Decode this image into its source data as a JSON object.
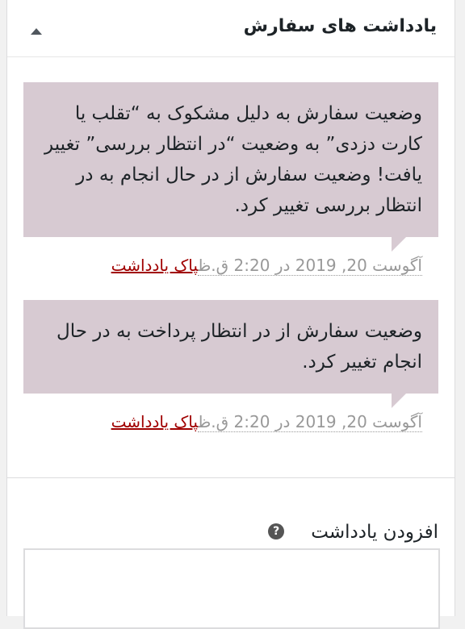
{
  "panel": {
    "title": "یادداشت های سفارش",
    "toggle_icon": "triangle-up-icon"
  },
  "notes": [
    {
      "text": "وضعیت سفارش به دلیل مشکوک به “تقلب یا کارت دزدی” به وضعیت “در انتظار بررسی” تغییر یافت! وضعیت سفارش از در حال انجام به در انتظار بررسی تغییر کرد.",
      "date": "آگوست 20, 2019 در 2:20 ق.ظ",
      "delete_label": "پاک یادداشت"
    },
    {
      "text": "وضعیت سفارش از در انتظار پرداخت به در حال انجام تغییر کرد.",
      "date": "آگوست 20, 2019 در 2:20 ق.ظ",
      "delete_label": "پاک یادداشت"
    }
  ],
  "add_note": {
    "label": "افزودن یادداشت",
    "help_icon": "question-circle-icon",
    "help_glyph": "?",
    "textarea_value": ""
  },
  "colors": {
    "note_background": "#d7cad2",
    "delete_link": "#a00000",
    "meta_text": "#999999"
  }
}
